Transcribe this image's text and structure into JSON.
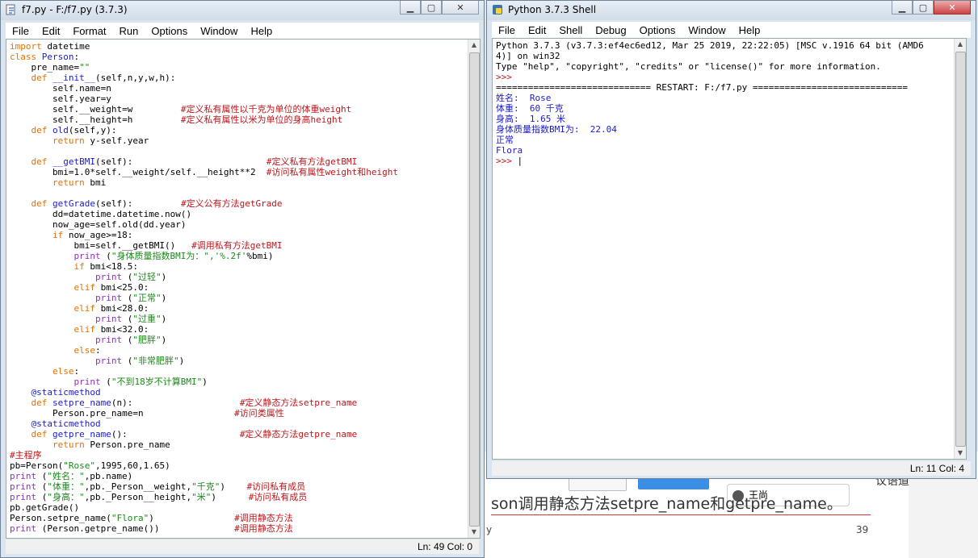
{
  "background_doc": {
    "big_text": "son调用静态方法setpre_name和getpre_name。",
    "chat_name": "王尚",
    "page_number": "39",
    "left_letter": "y",
    "right_text": "议语道"
  },
  "editor_window": {
    "title": "f7.py - F:/f7.py (3.7.3)",
    "menu": [
      "File",
      "Edit",
      "Format",
      "Run",
      "Options",
      "Window",
      "Help"
    ],
    "status": "Ln: 49   Col: 0",
    "code_lines": [
      [
        [
          "kw",
          "import"
        ],
        [
          "t",
          " datetime"
        ]
      ],
      [
        [
          "kw",
          "class"
        ],
        [
          "t",
          " "
        ],
        [
          "df",
          "Person"
        ],
        [
          "t",
          ":"
        ]
      ],
      [
        [
          "t",
          "    pre_name="
        ],
        [
          "st",
          "\"\""
        ]
      ],
      [
        [
          "t",
          "    "
        ],
        [
          "kw",
          "def"
        ],
        [
          "t",
          " "
        ],
        [
          "df",
          "__init__"
        ],
        [
          "t",
          "(self,n,y,w,h):"
        ]
      ],
      [
        [
          "t",
          "        self.name=n"
        ]
      ],
      [
        [
          "t",
          "        self.year=y"
        ]
      ],
      [
        [
          "t",
          "        self.__weight=w         "
        ],
        [
          "cm",
          "#定义私有属性以千克为单位的体重weight"
        ]
      ],
      [
        [
          "t",
          "        self.__height=h         "
        ],
        [
          "cm",
          "#定义私有属性以米为单位的身高height"
        ]
      ],
      [
        [
          "t",
          "    "
        ],
        [
          "kw",
          "def"
        ],
        [
          "t",
          " "
        ],
        [
          "df",
          "old"
        ],
        [
          "t",
          "(self,y):"
        ]
      ],
      [
        [
          "t",
          "        "
        ],
        [
          "kw",
          "return"
        ],
        [
          "t",
          " y-self.year"
        ]
      ],
      [
        [
          "t",
          ""
        ]
      ],
      [
        [
          "t",
          "    "
        ],
        [
          "kw",
          "def"
        ],
        [
          "t",
          " "
        ],
        [
          "df",
          "__getBMI"
        ],
        [
          "t",
          "(self):                         "
        ],
        [
          "cm",
          "#定义私有方法getBMI"
        ]
      ],
      [
        [
          "t",
          "        bmi=1.0*self.__weight/self.__height**2  "
        ],
        [
          "cm",
          "#访问私有属性weight和height"
        ]
      ],
      [
        [
          "t",
          "        "
        ],
        [
          "kw",
          "return"
        ],
        [
          "t",
          " bmi"
        ]
      ],
      [
        [
          "t",
          ""
        ]
      ],
      [
        [
          "t",
          "    "
        ],
        [
          "kw",
          "def"
        ],
        [
          "t",
          " "
        ],
        [
          "df",
          "getGrade"
        ],
        [
          "t",
          "(self):         "
        ],
        [
          "cm",
          "#定义公有方法getGrade"
        ]
      ],
      [
        [
          "t",
          "        dd=datetime.datetime.now()"
        ]
      ],
      [
        [
          "t",
          "        now_age=self.old(dd.year)"
        ]
      ],
      [
        [
          "t",
          "        "
        ],
        [
          "kw",
          "if"
        ],
        [
          "t",
          " now_age>=18:"
        ]
      ],
      [
        [
          "t",
          "            bmi=self.__getBMI()   "
        ],
        [
          "cm",
          "#调用私有方法getBMI"
        ]
      ],
      [
        [
          "t",
          "            "
        ],
        [
          "bi",
          "print"
        ],
        [
          "t",
          " ("
        ],
        [
          "st",
          "\"身体质量指数BMI为：\",'%.2f'"
        ],
        [
          "t",
          "%bmi)"
        ]
      ],
      [
        [
          "t",
          "            "
        ],
        [
          "kw",
          "if"
        ],
        [
          "t",
          " bmi<18.5:"
        ]
      ],
      [
        [
          "t",
          "                "
        ],
        [
          "bi",
          "print"
        ],
        [
          "t",
          " ("
        ],
        [
          "st",
          "\"过轻\""
        ],
        [
          "t",
          ")"
        ]
      ],
      [
        [
          "t",
          "            "
        ],
        [
          "kw",
          "elif"
        ],
        [
          "t",
          " bmi<25.0:"
        ]
      ],
      [
        [
          "t",
          "                "
        ],
        [
          "bi",
          "print"
        ],
        [
          "t",
          " ("
        ],
        [
          "st",
          "\"正常\""
        ],
        [
          "t",
          ")"
        ]
      ],
      [
        [
          "t",
          "            "
        ],
        [
          "kw",
          "elif"
        ],
        [
          "t",
          " bmi<28.0:"
        ]
      ],
      [
        [
          "t",
          "                "
        ],
        [
          "bi",
          "print"
        ],
        [
          "t",
          " ("
        ],
        [
          "st",
          "\"过重\""
        ],
        [
          "t",
          ")"
        ]
      ],
      [
        [
          "t",
          "            "
        ],
        [
          "kw",
          "elif"
        ],
        [
          "t",
          " bmi<32.0:"
        ]
      ],
      [
        [
          "t",
          "                "
        ],
        [
          "bi",
          "print"
        ],
        [
          "t",
          " ("
        ],
        [
          "st",
          "\"肥胖\""
        ],
        [
          "t",
          ")"
        ]
      ],
      [
        [
          "t",
          "            "
        ],
        [
          "kw",
          "else"
        ],
        [
          "t",
          ":"
        ]
      ],
      [
        [
          "t",
          "                "
        ],
        [
          "bi",
          "print"
        ],
        [
          "t",
          " ("
        ],
        [
          "st",
          "\"非常肥胖\""
        ],
        [
          "t",
          ")"
        ]
      ],
      [
        [
          "t",
          "        "
        ],
        [
          "kw",
          "else"
        ],
        [
          "t",
          ":"
        ]
      ],
      [
        [
          "t",
          "            "
        ],
        [
          "bi",
          "print"
        ],
        [
          "t",
          " ("
        ],
        [
          "st",
          "\"不到18岁不计算BMI\""
        ],
        [
          "t",
          ")"
        ]
      ],
      [
        [
          "t",
          "    "
        ],
        [
          "df",
          "@staticmethod"
        ]
      ],
      [
        [
          "t",
          "    "
        ],
        [
          "kw",
          "def"
        ],
        [
          "t",
          " "
        ],
        [
          "df",
          "setpre_name"
        ],
        [
          "t",
          "(n):                    "
        ],
        [
          "cm",
          "#定义静态方法setpre_name"
        ]
      ],
      [
        [
          "t",
          "        Person.pre_name=n                 "
        ],
        [
          "cm",
          "#访问类属性"
        ]
      ],
      [
        [
          "t",
          "    "
        ],
        [
          "df",
          "@staticmethod"
        ]
      ],
      [
        [
          "t",
          "    "
        ],
        [
          "kw",
          "def"
        ],
        [
          "t",
          " "
        ],
        [
          "df",
          "getpre_name"
        ],
        [
          "t",
          "():                     "
        ],
        [
          "cm",
          "#定义静态方法getpre_name"
        ]
      ],
      [
        [
          "t",
          "        "
        ],
        [
          "kw",
          "return"
        ],
        [
          "t",
          " Person.pre_name"
        ]
      ],
      [
        [
          "cm",
          "#主程序"
        ]
      ],
      [
        [
          "t",
          "pb=Person("
        ],
        [
          "st",
          "\"Rose\""
        ],
        [
          "t",
          ",1995,60,1.65)"
        ]
      ],
      [
        [
          "bi",
          "print"
        ],
        [
          "t",
          " ("
        ],
        [
          "st",
          "\"姓名：\""
        ],
        [
          "t",
          ",pb.name)"
        ]
      ],
      [
        [
          "bi",
          "print"
        ],
        [
          "t",
          " ("
        ],
        [
          "st",
          "\"体重：\""
        ],
        [
          "t",
          ",pb._Person__weight,"
        ],
        [
          "st",
          "\"千克\""
        ],
        [
          "t",
          ")    "
        ],
        [
          "cm",
          "#访问私有成员"
        ]
      ],
      [
        [
          "bi",
          "print"
        ],
        [
          "t",
          " ("
        ],
        [
          "st",
          "\"身高：\""
        ],
        [
          "t",
          ",pb._Person__height,"
        ],
        [
          "st",
          "\"米\""
        ],
        [
          "t",
          ")      "
        ],
        [
          "cm",
          "#访问私有成员"
        ]
      ],
      [
        [
          "t",
          "pb.getGrade()"
        ]
      ],
      [
        [
          "t",
          "Person.setpre_name("
        ],
        [
          "st",
          "\"Flora\""
        ],
        [
          "t",
          ")               "
        ],
        [
          "cm",
          "#调用静态方法"
        ]
      ],
      [
        [
          "bi",
          "print"
        ],
        [
          "t",
          " (Person.getpre_name())              "
        ],
        [
          "cm",
          "#调用静态方法"
        ]
      ]
    ]
  },
  "shell_window": {
    "title": "Python 3.7.3 Shell",
    "menu": [
      "File",
      "Edit",
      "Shell",
      "Debug",
      "Options",
      "Window",
      "Help"
    ],
    "status": "Ln: 11   Col: 4",
    "lines": [
      [
        [
          "t",
          "Python 3.7.3 (v3.7.3:ef4ec6ed12, Mar 25 2019, 22:22:05) [MSC v.1916 64 bit (AMD6"
        ]
      ],
      [
        [
          "t",
          "4)] on win32"
        ]
      ],
      [
        [
          "t",
          "Type \"help\", \"copyright\", \"credits\" or \"license()\" for more information."
        ]
      ],
      [
        [
          "cm",
          ">>> "
        ]
      ],
      [
        [
          "t",
          "============================= RESTART: F:/f7.py ============================="
        ]
      ],
      [
        [
          "ou",
          "姓名:  Rose"
        ]
      ],
      [
        [
          "ou",
          "体重:  60 千克"
        ]
      ],
      [
        [
          "ou",
          "身高:  1.65 米"
        ]
      ],
      [
        [
          "ou",
          "身体质量指数BMI为:  22.04"
        ]
      ],
      [
        [
          "ou",
          "正常"
        ]
      ],
      [
        [
          "ou",
          "Flora"
        ]
      ],
      [
        [
          "cm",
          ">>> "
        ],
        [
          "t",
          "|"
        ]
      ]
    ]
  }
}
